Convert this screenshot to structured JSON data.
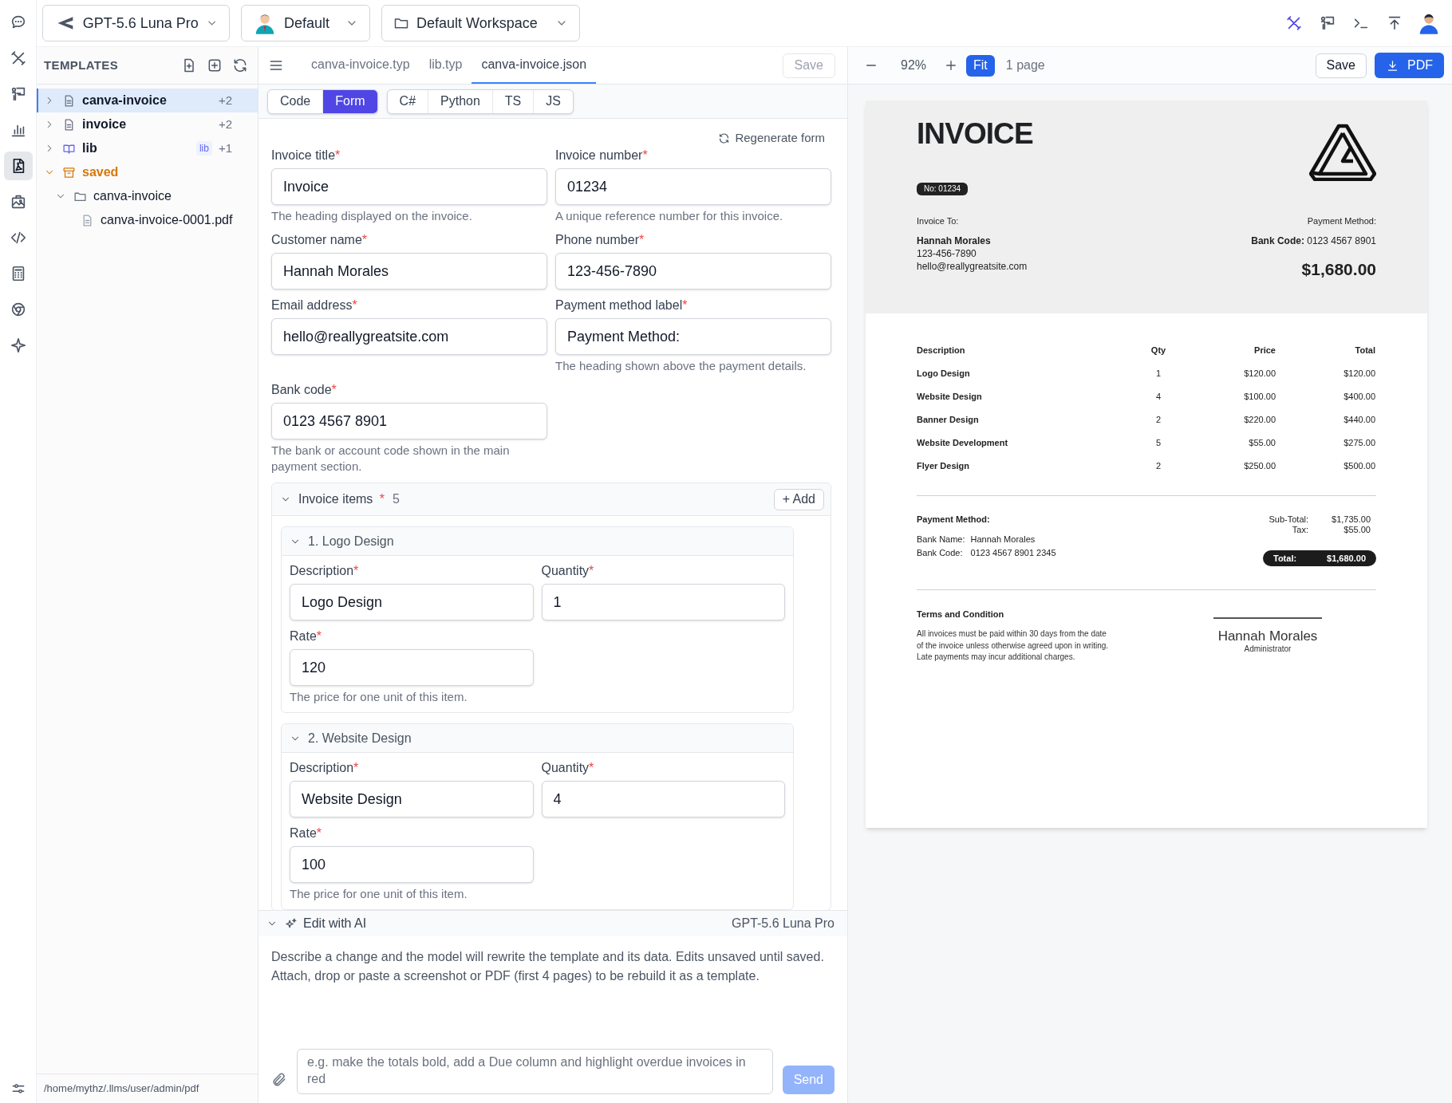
{
  "rail": {
    "items": [
      {
        "kind": "chat",
        "selected": false
      },
      {
        "kind": "tools",
        "selected": false
      },
      {
        "kind": "presenter",
        "selected": false
      },
      {
        "kind": "chart",
        "selected": false
      },
      {
        "kind": "pdf",
        "selected": true
      },
      {
        "kind": "image",
        "selected": false
      },
      {
        "kind": "code",
        "selected": false
      },
      {
        "kind": "calculator",
        "selected": false
      },
      {
        "kind": "browser",
        "selected": false
      },
      {
        "kind": "sparkle",
        "selected": false
      }
    ]
  },
  "top_bar": {
    "selectors": [
      {
        "kind": "model",
        "label": "GPT-5.6 Luna Pro"
      },
      {
        "kind": "profile",
        "label": "Default"
      },
      {
        "kind": "workspace",
        "label": "Default Workspace"
      }
    ],
    "actions": [
      {
        "kind": "tools",
        "selected": true
      },
      {
        "kind": "presenter",
        "selected": false
      },
      {
        "kind": "terminal",
        "selected": false
      },
      {
        "kind": "upload",
        "selected": false
      }
    ]
  },
  "sidebar": {
    "title": "TEMPLATES",
    "tree": [
      {
        "kind": "file",
        "label": "canva-invoice",
        "count": "+2",
        "expanded": false,
        "selected": true
      },
      {
        "kind": "file",
        "label": "invoice",
        "count": "+2",
        "expanded": false,
        "selected": false
      },
      {
        "kind": "book",
        "label": "lib",
        "tag": "lib",
        "count": "+1",
        "expanded": false,
        "selected": false
      },
      {
        "kind": "archive",
        "label": "saved",
        "expanded": true,
        "selected": false,
        "children": [
          {
            "kind": "folder",
            "label": "canva-invoice",
            "expanded": true,
            "selected": false,
            "children": [
              {
                "kind": "pdf-file",
                "label": "canva-invoice-0001.pdf",
                "selected": false
              }
            ]
          }
        ]
      }
    ],
    "path": "/home/mythz/.llms/user/admin/pdf"
  },
  "editor": {
    "file_tabs": [
      {
        "label": "canva-invoice.typ",
        "selected": false
      },
      {
        "label": "lib.typ",
        "selected": false
      },
      {
        "label": "canva-invoice.json",
        "selected": true
      }
    ],
    "save_button": {
      "label": "Save",
      "disabled": true
    },
    "mode_tabs": [
      {
        "label": "Code",
        "selected": false
      },
      {
        "label": "Form",
        "selected": true
      }
    ],
    "language_tabs": [
      {
        "label": "C#",
        "selected": false
      },
      {
        "label": "Python",
        "selected": false
      },
      {
        "label": "TS",
        "selected": false
      },
      {
        "label": "JS",
        "selected": false
      }
    ],
    "regenerate_button": "Regenerate form",
    "fields": [
      {
        "label": "Invoice title",
        "required_mark": "*",
        "value": "Invoice",
        "help": "The heading displayed on the invoice."
      },
      {
        "label": "Invoice number",
        "required_mark": "*",
        "value": "01234",
        "help": "A unique reference number for this invoice."
      },
      {
        "label": "Customer name",
        "required_mark": "*",
        "value": "Hannah Morales"
      },
      {
        "label": "Phone number",
        "required_mark": "*",
        "value": "123-456-7890"
      },
      {
        "label": "Email address",
        "required_mark": "*",
        "value": "hello@reallygreatsite.com"
      },
      {
        "label": "Payment method label",
        "required_mark": "*",
        "value": "Payment Method:",
        "help": "The heading shown above the payment details."
      },
      {
        "label": "Bank code",
        "required_mark": "*",
        "value": "0123 4567 8901",
        "help": "The bank or account code shown in the main payment section."
      }
    ],
    "items_section": {
      "title": "Invoice items",
      "required_mark": "*",
      "count": "5",
      "add_button": "+ Add",
      "expanded": true,
      "items": [
        {
          "title": "1. Logo Design",
          "expanded": true,
          "fields": [
            {
              "label": "Description",
              "required_mark": "*",
              "value": "Logo Design"
            },
            {
              "label": "Quantity",
              "required_mark": "*",
              "value": "1"
            },
            {
              "label": "Rate",
              "required_mark": "*",
              "value": "120",
              "help": "The price for one unit of this item."
            }
          ]
        },
        {
          "title": "2. Website Design",
          "expanded": true,
          "fields": [
            {
              "label": "Description",
              "required_mark": "*",
              "value": "Website Design"
            },
            {
              "label": "Quantity",
              "required_mark": "*",
              "value": "4"
            },
            {
              "label": "Rate",
              "required_mark": "*",
              "value": "100",
              "help": "The price for one unit of this item."
            }
          ]
        }
      ]
    }
  },
  "ai_panel": {
    "title": "Edit with AI",
    "expanded": true,
    "model": "GPT-5.6 Luna Pro",
    "description": [
      "Describe a change and the model will rewrite the template and its data. Edits unsaved until saved.",
      "Attach, drop or paste a screenshot or PDF (first 4 pages) to be rebuild it as a template."
    ],
    "input": {
      "placeholder": "e.g. make the totals bold, add a Due column and highlight overdue invoices in red"
    },
    "send_button": {
      "label": "Send",
      "disabled": true
    }
  },
  "preview": {
    "zoom": "92%",
    "fit_button": {
      "label": "Fit",
      "selected": true
    },
    "pages": "1 page",
    "save_button": "Save",
    "pdf_button": "PDF",
    "document": {
      "title": "INVOICE",
      "number_badge": "No: 01234",
      "bill_to": {
        "heading": "Invoice To:",
        "name": "Hannah Morales",
        "phone": "123-456-7890",
        "email": "hello@reallygreatsite.com"
      },
      "payment": {
        "heading": "Payment Method:",
        "bank_code": "**Bank Code:** 0123 4567 8901",
        "amount": "$1,680.00"
      },
      "table": {
        "columns": [
          "Description",
          "Qty",
          "Price",
          "Total"
        ],
        "rows": [
          [
            "Logo Design",
            "1",
            "$120.00",
            "$120.00"
          ],
          [
            "Website Design",
            "4",
            "$100.00",
            "$400.00"
          ],
          [
            "Banner Design",
            "2",
            "$220.00",
            "$440.00"
          ],
          [
            "Website Development",
            "5",
            "$55.00",
            "$275.00"
          ],
          [
            "Flyer Design",
            "2",
            "$250.00",
            "$500.00"
          ]
        ]
      },
      "payment_details": {
        "heading": "Payment Method:",
        "lines": [
          {
            "label": "Bank Name:",
            "value": "Hannah Morales"
          },
          {
            "label": "Bank Code:",
            "value": "0123 4567 8901 2345"
          }
        ]
      },
      "summary": [
        {
          "label": "Sub-Total:",
          "value": "$1,735.00"
        },
        {
          "label": "Tax:",
          "value": "$55.00"
        }
      ],
      "total": {
        "label": "Total:",
        "value": "$1,680.00"
      },
      "terms": {
        "heading": "Terms and Condition",
        "lines": [
          "All invoices must be paid within 30 days from the date",
          "of the invoice unless otherwise agreed upon in writing.",
          "Late payments may incur additional charges."
        ]
      },
      "signature": {
        "name": "Hannah Morales",
        "role": "Administrator"
      }
    }
  }
}
